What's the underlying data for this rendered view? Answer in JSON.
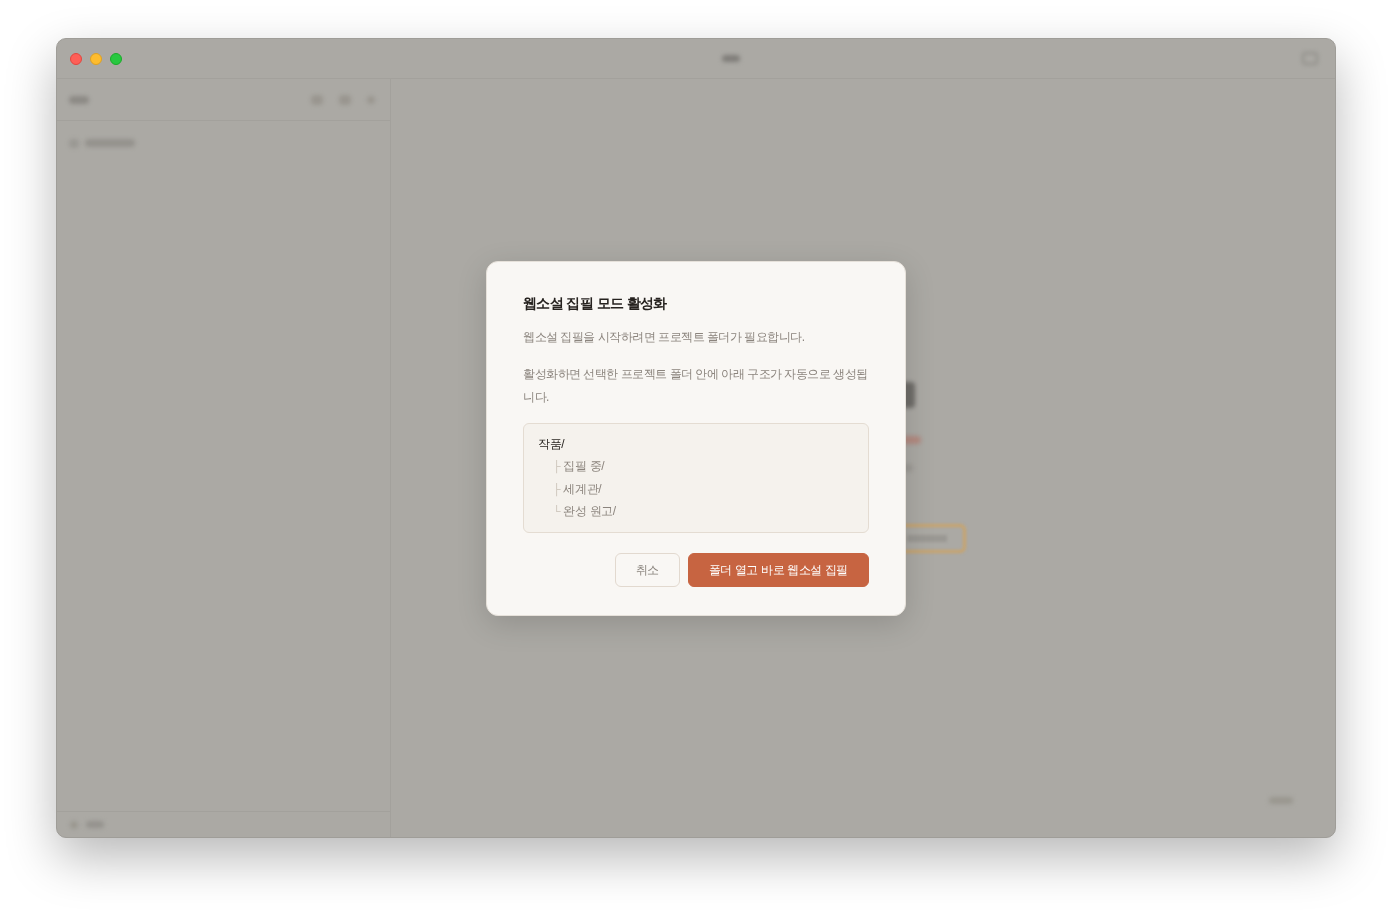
{
  "dialog": {
    "title": "웹소설 집필 모드 활성화",
    "paragraphs": [
      "웹소설 집필을 시작하려면 프로젝트 폴더가 필요합니다.",
      "활성화하면 선택한 프로젝트 폴더 안에 아래 구조가 자동으로 생성됩니다."
    ],
    "folder_tree": {
      "name": "작품/",
      "children": [
        {
          "connector": "├",
          "name": "집필 중/"
        },
        {
          "connector": "├",
          "name": "세계관/"
        },
        {
          "connector": "└",
          "name": "완성 원고/"
        }
      ]
    },
    "buttons": [
      {
        "kind": "secondary",
        "label": "취소"
      },
      {
        "kind": "primary",
        "label": "폴더 열고 바로 웹소설 집필"
      }
    ]
  }
}
